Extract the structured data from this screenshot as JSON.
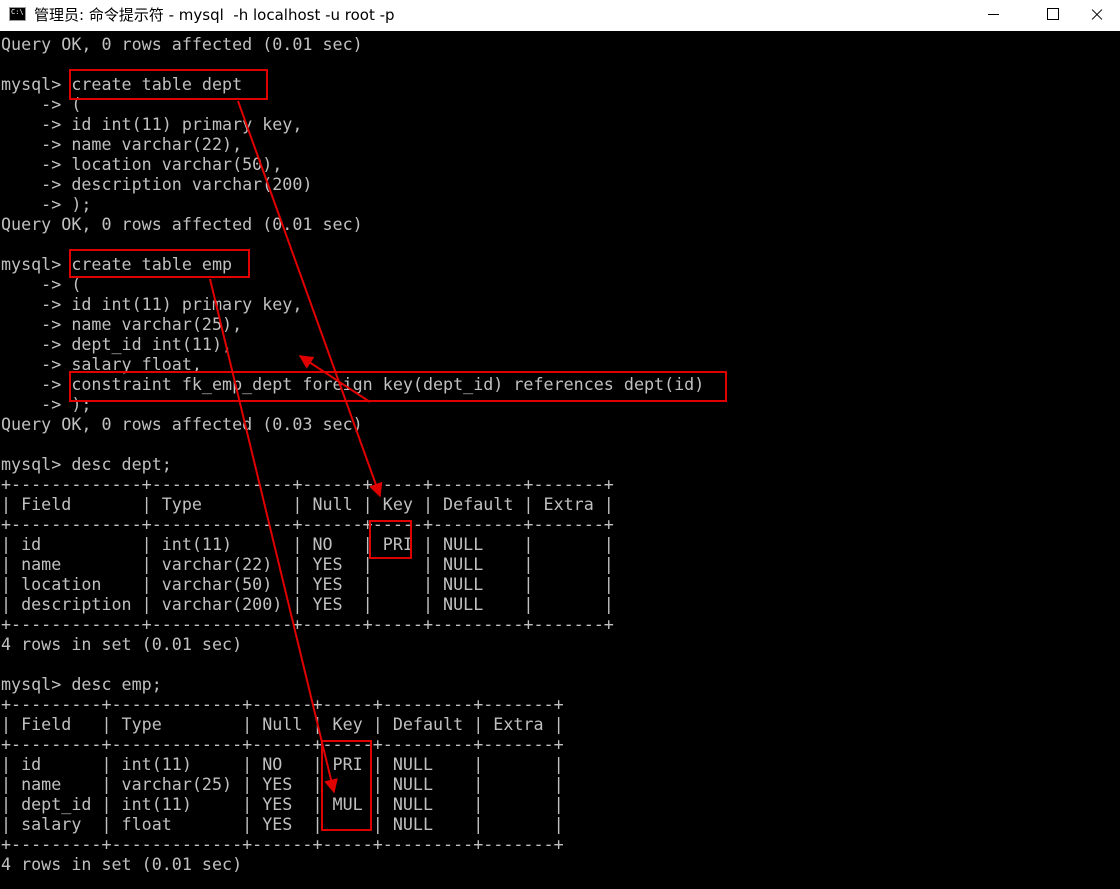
{
  "window": {
    "title": "管理员: 命令提示符 - mysql  -h localhost -u root -p",
    "icon": "cmd-icon",
    "icon_text": "C:\\"
  },
  "console": {
    "lines": [
      "Query OK, 0 rows affected (0.01 sec)",
      "",
      "mysql> create table dept",
      "    -> (",
      "    -> id int(11) primary key,",
      "    -> name varchar(22),",
      "    -> location varchar(50),",
      "    -> description varchar(200)",
      "    -> );",
      "Query OK, 0 rows affected (0.01 sec)",
      "",
      "mysql> create table emp",
      "    -> (",
      "    -> id int(11) primary key,",
      "    -> name varchar(25),",
      "    -> dept_id int(11),",
      "    -> salary float,",
      "    -> constraint fk_emp_dept foreign key(dept_id) references dept(id)",
      "    -> );",
      "Query OK, 0 rows affected (0.03 sec)",
      "",
      "mysql> desc dept;",
      "+-------------+--------------+------+-----+---------+-------+",
      "| Field       | Type         | Null | Key | Default | Extra |",
      "+-------------+--------------+------+-----+---------+-------+",
      "| id          | int(11)      | NO   | PRI | NULL    |       |",
      "| name        | varchar(22)  | YES  |     | NULL    |       |",
      "| location    | varchar(50)  | YES  |     | NULL    |       |",
      "| description | varchar(200) | YES  |     | NULL    |       |",
      "+-------------+--------------+------+-----+---------+-------+",
      "4 rows in set (0.01 sec)",
      "",
      "mysql> desc emp;",
      "+---------+-------------+------+-----+---------+-------+",
      "| Field   | Type        | Null | Key | Default | Extra |",
      "+---------+-------------+------+-----+---------+-------+",
      "| id      | int(11)     | NO   | PRI | NULL    |       |",
      "| name    | varchar(25) | YES  |     | NULL    |       |",
      "| dept_id | int(11)     | YES  | MUL | NULL    |       |",
      "| salary  | float       | YES  |     | NULL    |       |",
      "+---------+-------------+------+-----+---------+-------+",
      "4 rows in set (0.01 sec)"
    ]
  },
  "annotation_color": "#e00000"
}
